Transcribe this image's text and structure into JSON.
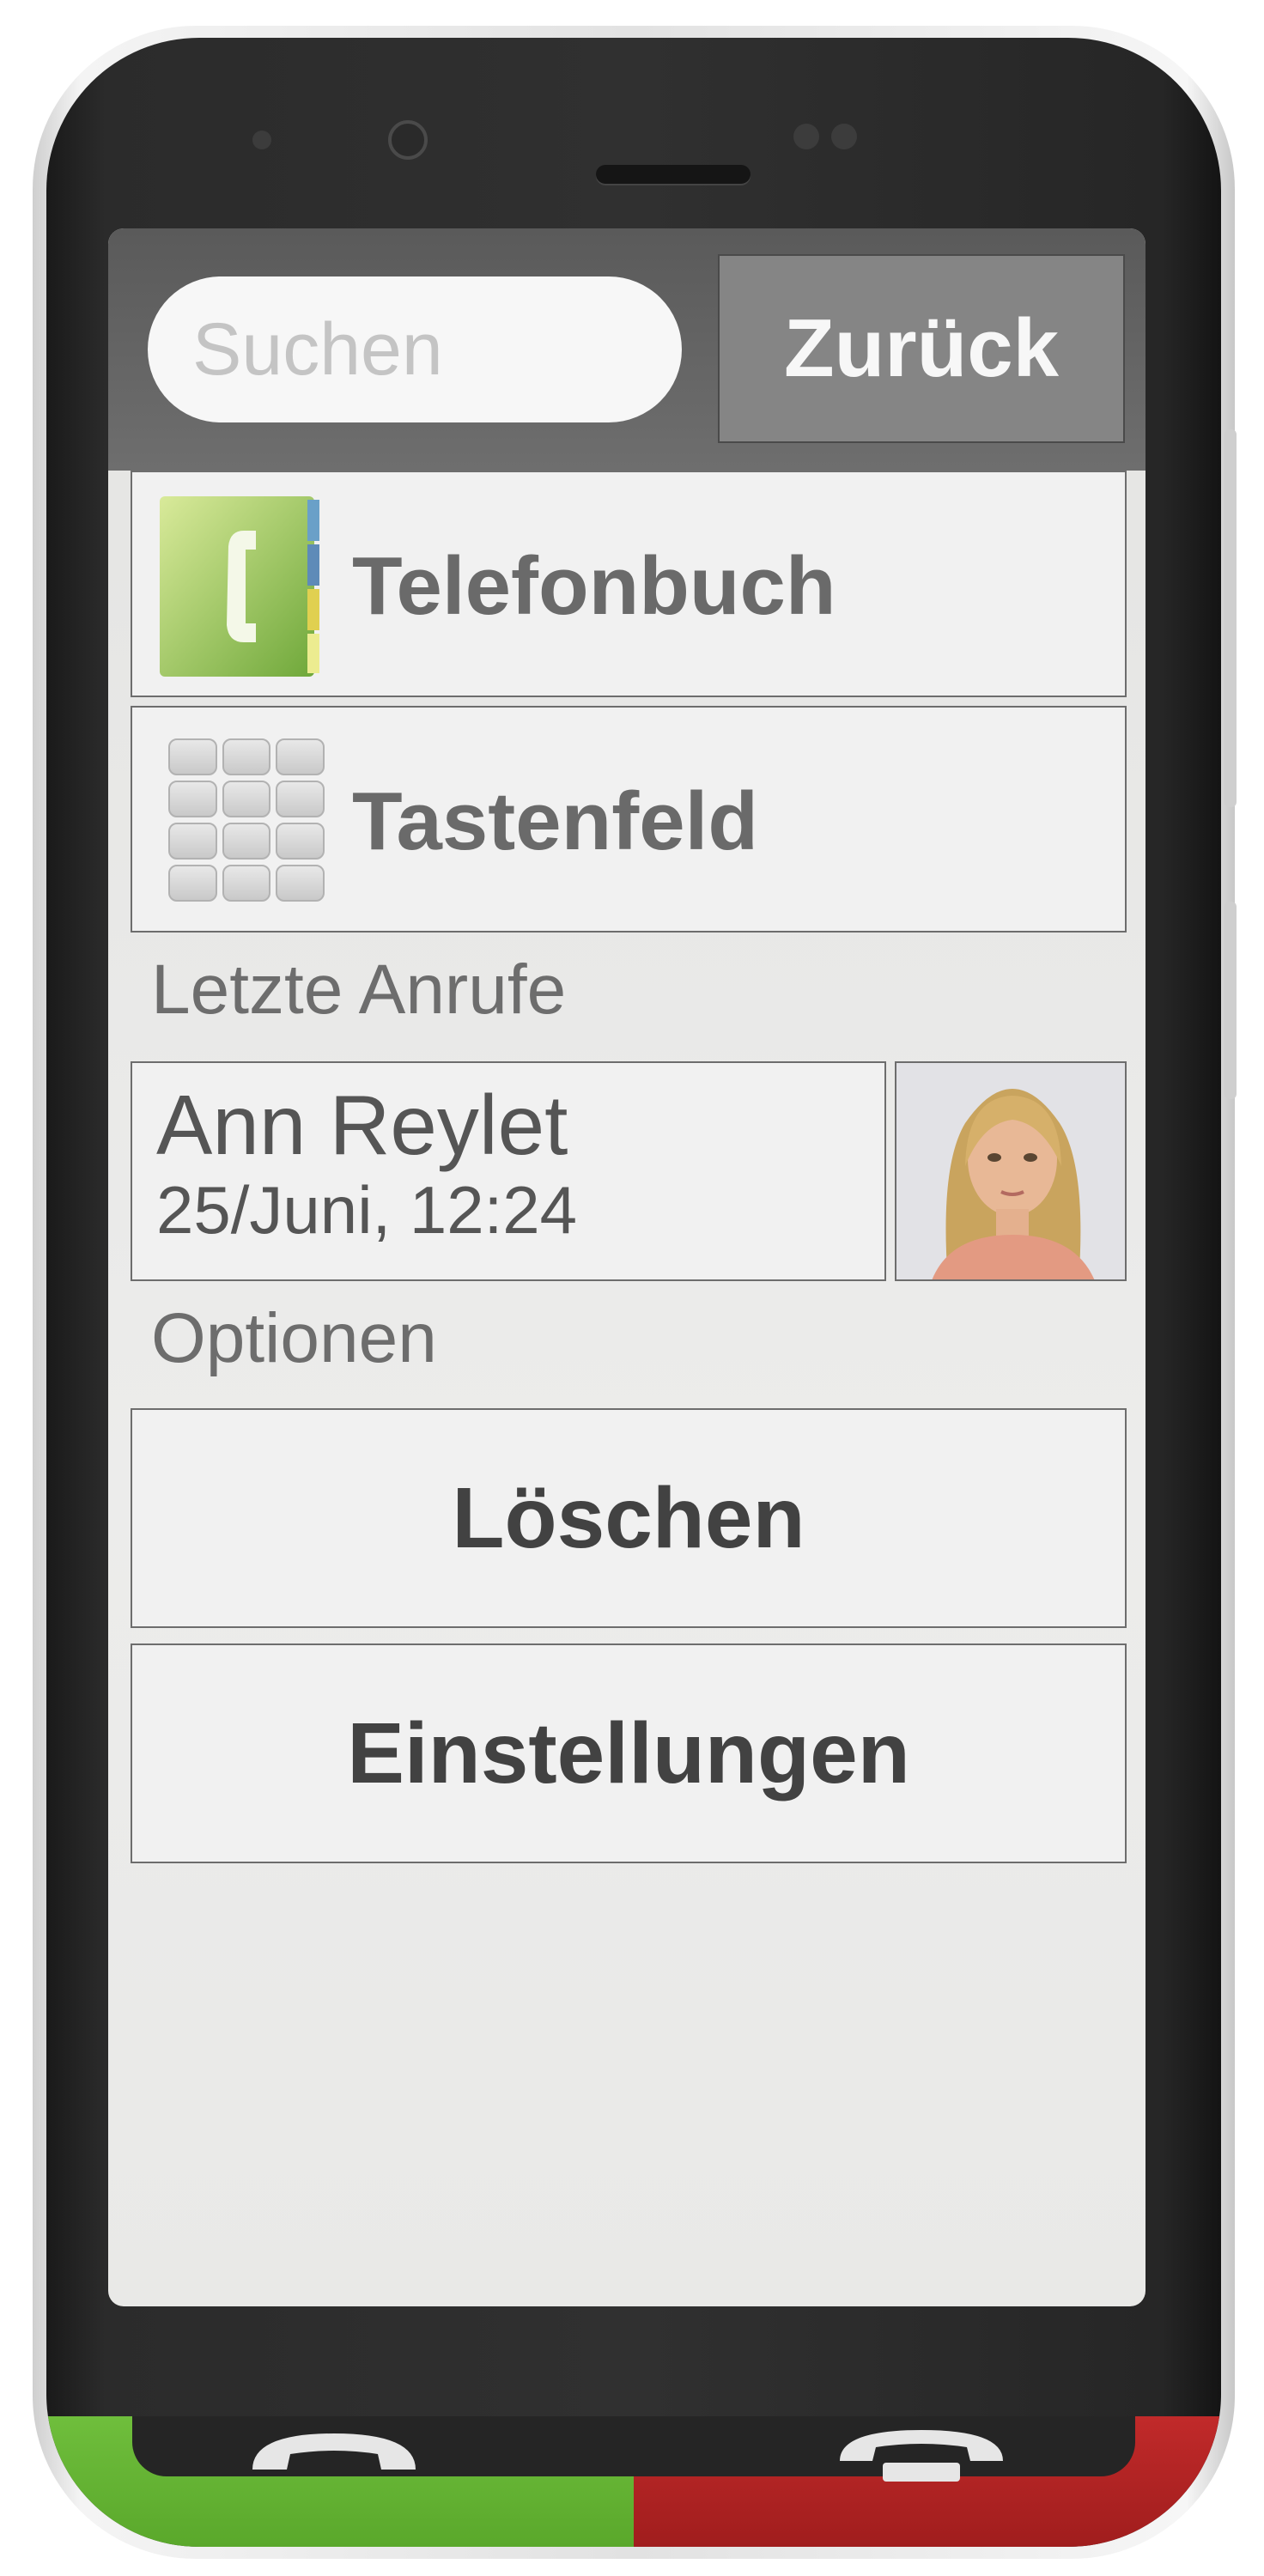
{
  "search": {
    "placeholder": "Suchen"
  },
  "header": {
    "back_label": "Zurück"
  },
  "menu": {
    "phonebook_label": "Telefonbuch",
    "keypad_label": "Tastenfeld"
  },
  "recent_calls": {
    "title": "Letzte Anrufe",
    "entries": [
      {
        "name": "Ann Reylet",
        "datetime": "25/Juni, 12:24"
      }
    ]
  },
  "options": {
    "title": "Optionen",
    "delete_label": "Löschen",
    "settings_label": "Einstellungen"
  },
  "colors": {
    "call_accept": "#6fbe3c",
    "call_end": "#c12a2a",
    "header_bar": "#666666",
    "phonebook_icon": "#8cc152"
  },
  "icons": [
    "phonebook-icon",
    "keypad-icon",
    "contact-photo",
    "accept-call-icon",
    "end-call-icon"
  ]
}
